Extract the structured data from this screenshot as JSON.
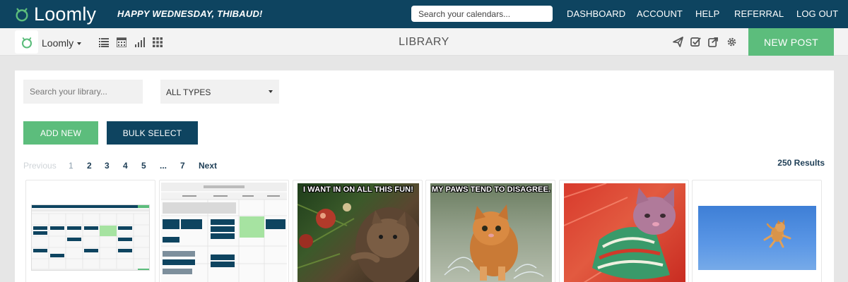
{
  "app": {
    "name": "Loomly",
    "greeting": "HAPPY WEDNESDAY, THIBAUD!",
    "brand_color": "#0e4460",
    "accent_color": "#5cbd7c"
  },
  "header": {
    "search_placeholder": "Search your calendars...",
    "nav": [
      "DASHBOARD",
      "ACCOUNT",
      "HELP",
      "REFERRAL",
      "LOG OUT"
    ]
  },
  "subheader": {
    "calendar_name": "Loomly",
    "view_icons": [
      "list-view-icon",
      "calendar-view-icon",
      "analytics-icon",
      "grid-view-icon"
    ],
    "title": "LIBRARY",
    "tool_icons": [
      "send-icon",
      "approve-icon",
      "share-icon",
      "settings-icon"
    ],
    "new_post_label": "NEW POST"
  },
  "library": {
    "search_placeholder": "Search your library...",
    "type_filter": "ALL TYPES",
    "add_new_label": "ADD NEW",
    "bulk_select_label": "BULK SELECT",
    "pagination": {
      "previous": "Previous",
      "pages": [
        "1",
        "2",
        "3",
        "4",
        "5",
        "...",
        "7"
      ],
      "next": "Next",
      "current": "1"
    },
    "results": "250 Results",
    "items": [
      {
        "kind": "calendar-screenshot",
        "caption": ""
      },
      {
        "kind": "calendar-week-screenshot",
        "caption": ""
      },
      {
        "kind": "cat-meme",
        "caption": "I WANT IN ON ALL THIS FUN!"
      },
      {
        "kind": "cat-meme",
        "caption": "MY PAWS TEND TO DISAGREE."
      },
      {
        "kind": "cat-photo",
        "caption": ""
      },
      {
        "kind": "cat-photo",
        "caption": ""
      }
    ]
  }
}
